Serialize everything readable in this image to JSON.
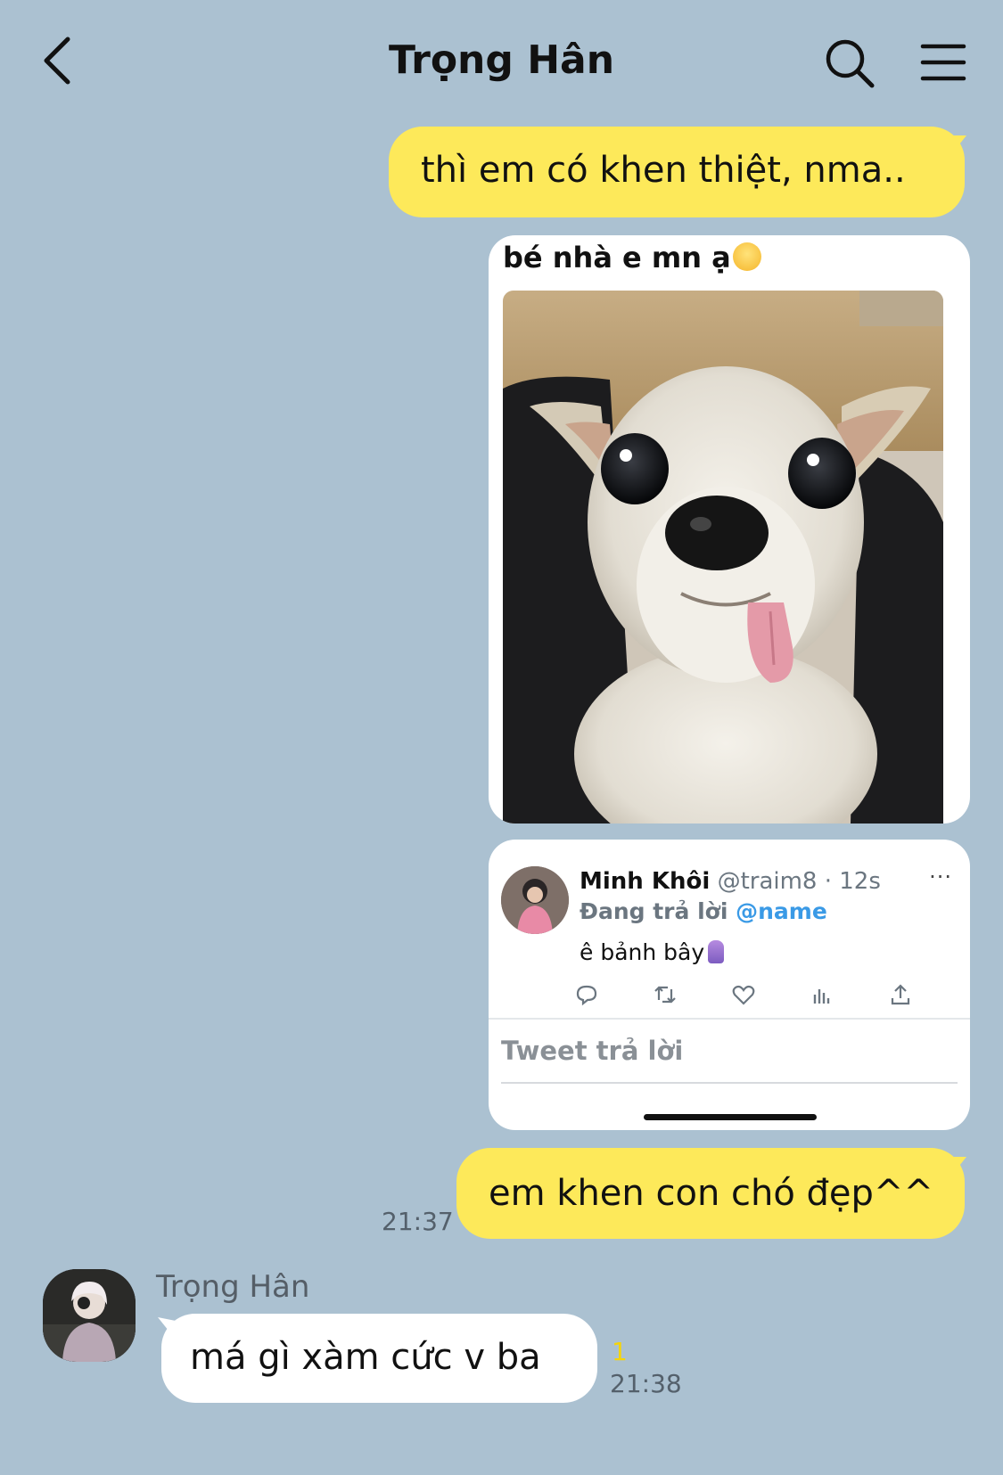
{
  "header": {
    "title": "Trọng Hân",
    "back_icon": "chevron-left-icon",
    "search_icon": "search-icon",
    "menu_icon": "hamburger-menu-icon"
  },
  "messages": {
    "sent_1": {
      "text": "thì em có khen thiệt, nma.."
    },
    "photo_card": {
      "caption": "bé nhà e mn ạ",
      "caption_emoji": "smiling-face-emoji"
    },
    "tweet_card": {
      "author_name": "Minh Khôi",
      "author_handle": "@traim8 · 12s",
      "replying_prefix": "Đang trả lời",
      "replying_mention": "@name",
      "more": "···",
      "text": "ê bảnh bây",
      "reply_placeholder": "Tweet trả lời",
      "actions": [
        "reply-icon",
        "retweet-icon",
        "like-icon",
        "analytics-icon",
        "share-icon"
      ]
    },
    "sent_2": {
      "text": "em khen con chó đẹp^^",
      "time": "21:37"
    },
    "received_1": {
      "sender": "Trọng Hân",
      "text": "má gì xàm cức v ba",
      "unread": "1",
      "time": "21:38"
    }
  },
  "colors": {
    "background": "#abc1d1",
    "sent_bubble": "#fde95a",
    "received_bubble": "#ffffff",
    "mention": "#3a9ae6",
    "unread": "#f5d40a"
  }
}
